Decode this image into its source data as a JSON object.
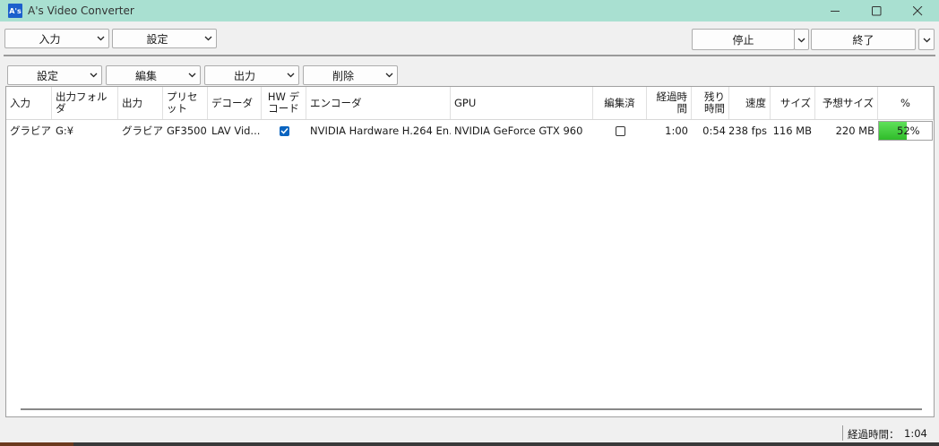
{
  "window": {
    "icon_text": "A's",
    "title": "A's Video Converter"
  },
  "toolbar": {
    "input": "入力",
    "settings": "設定",
    "stop": "停止",
    "finish": "終了"
  },
  "subtoolbar": {
    "settings": "設定",
    "edit": "編集",
    "output": "出力",
    "delete": "削除"
  },
  "table": {
    "columns": [
      "入力",
      "出力フォルダ",
      "出力",
      "プリセット",
      "デコーダ",
      "HW デコード",
      "エンコーダ",
      "GPU",
      "編集済",
      "経過時間",
      "残り時間",
      "速度",
      "サイズ",
      "予想サイズ",
      "%"
    ],
    "rows": [
      {
        "input": "グラビア...",
        "output_folder": "G:¥",
        "output": "グラビア...",
        "preset": "GF3500",
        "decoder": "LAV Vid...",
        "hw_decode": true,
        "encoder": "NVIDIA Hardware H.264 En...",
        "gpu": "NVIDIA GeForce GTX 960",
        "edited": false,
        "elapsed": "1:00",
        "remaining": "0:54",
        "speed": "238 fps",
        "size": "116 MB",
        "est_size": "220 MB",
        "percent_value": 52,
        "percent_text": "52",
        "percent_sign": "%"
      }
    ]
  },
  "status": {
    "label": "経過時間：",
    "value": "1:04"
  },
  "colors": {
    "titlebar": "#a9e0d1",
    "progress": "#3cc836",
    "checkbox": "#0a64c0"
  }
}
